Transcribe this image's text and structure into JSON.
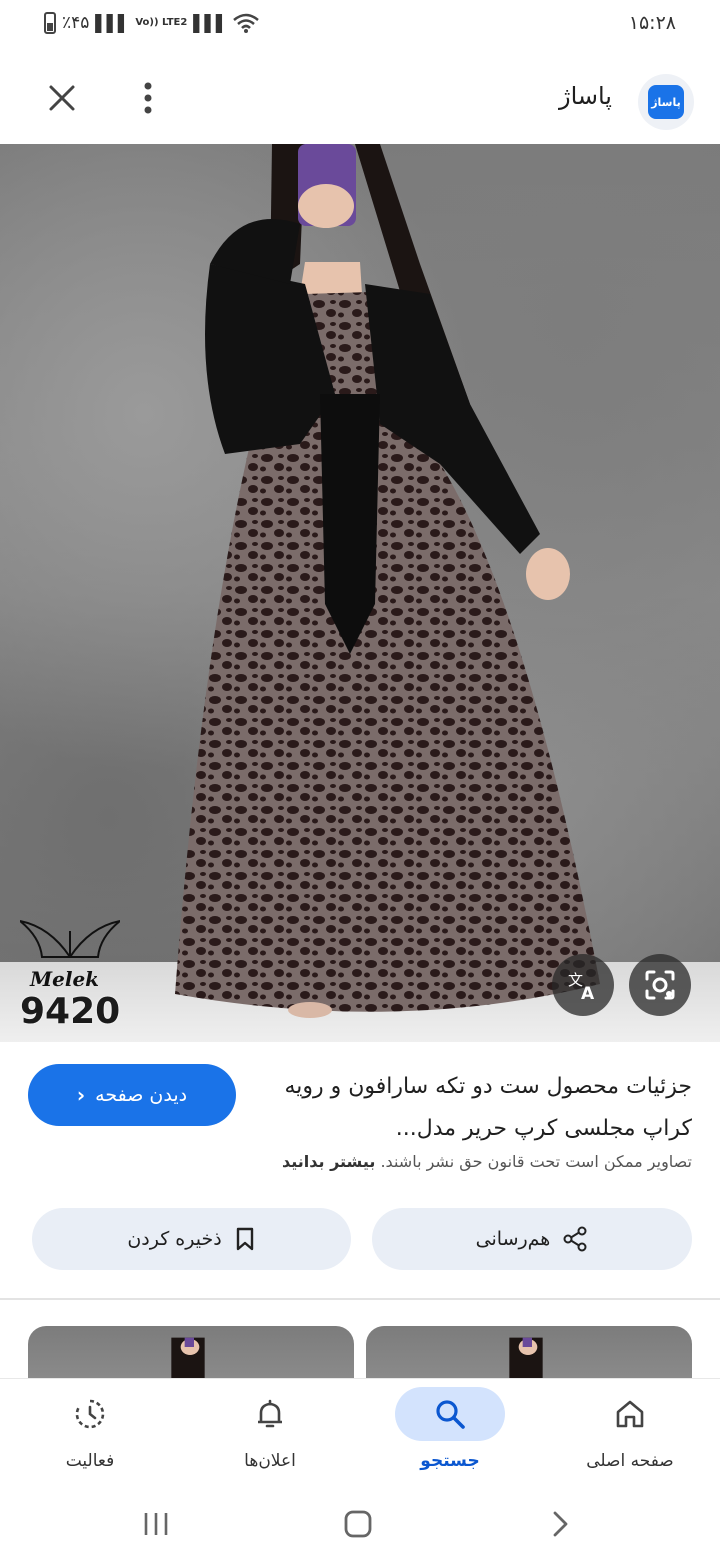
{
  "status_bar": {
    "battery_text": "٪۴۵",
    "network_text": "Vo)) LTE2",
    "time": "۱۵:۲۸"
  },
  "header": {
    "site_name": "پاساژ",
    "logo_text": "پاساژ"
  },
  "image": {
    "watermark_name": "Melek",
    "watermark_code": "9420",
    "translate_icon": "translate-icon",
    "lens_icon": "lens-icon"
  },
  "details": {
    "title": "جزئیات محصول ست دو تکه سارافون و رویه کراپ مجلسی کرپ حریر مدل...",
    "visit_label": "دیدن صفحه",
    "copyright_text": "تصاویر ممکن است تحت قانون حق نشر باشند.",
    "learn_more": "بیشتر بدانید",
    "share_label": "هم‌رسانی",
    "save_label": "ذخیره کردن"
  },
  "bottom_nav": {
    "items": [
      {
        "label": "صفحه اصلی",
        "icon": "home-icon",
        "active": false
      },
      {
        "label": "جستجو",
        "icon": "search-icon",
        "active": true
      },
      {
        "label": "اعلان‌ها",
        "icon": "bell-icon",
        "active": false
      },
      {
        "label": "فعالیت",
        "icon": "activity-icon",
        "active": false
      }
    ]
  },
  "colors": {
    "accent": "#1a73e8",
    "active_pill": "#d3e3fd",
    "action_button_bg": "#e9eef6"
  }
}
